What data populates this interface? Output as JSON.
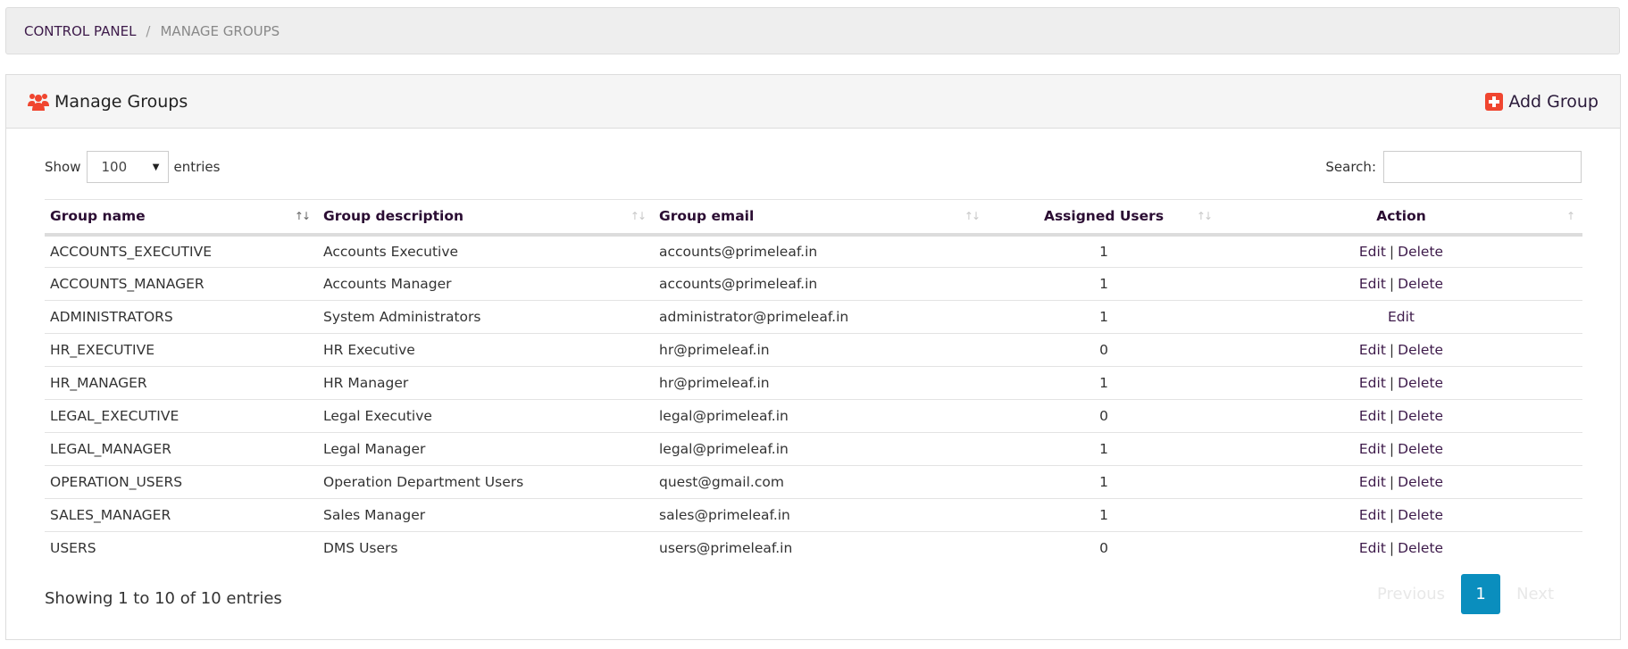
{
  "breadcrumb": {
    "items": [
      "CONTROL PANEL",
      "MANAGE GROUPS"
    ],
    "separator": "/"
  },
  "panel": {
    "title": "Manage Groups",
    "title_icon": "users-icon",
    "add_button": "Add Group",
    "add_icon": "plus-square-icon",
    "accent_color": "#f0452f"
  },
  "controls": {
    "show_label": "Show",
    "page_length": "100",
    "entries_label": "entries",
    "search_label": "Search:",
    "search_value": ""
  },
  "table": {
    "columns": [
      "Group name",
      "Group description",
      "Group email",
      "Assigned Users",
      "Action"
    ],
    "rows": [
      {
        "name": "ACCOUNTS_EXECUTIVE",
        "description": "Accounts Executive",
        "email": "accounts@primeleaf.in",
        "users": "1",
        "edit": "Edit",
        "delete": "Delete"
      },
      {
        "name": "ACCOUNTS_MANAGER",
        "description": "Accounts Manager",
        "email": "accounts@primeleaf.in",
        "users": "1",
        "edit": "Edit",
        "delete": "Delete"
      },
      {
        "name": "ADMINISTRATORS",
        "description": "System Administrators",
        "email": "administrator@primeleaf.in",
        "users": "1",
        "edit": "Edit",
        "delete": null
      },
      {
        "name": "HR_EXECUTIVE",
        "description": "HR Executive",
        "email": "hr@primeleaf.in",
        "users": "0",
        "edit": "Edit",
        "delete": "Delete"
      },
      {
        "name": "HR_MANAGER",
        "description": "HR Manager",
        "email": "hr@primeleaf.in",
        "users": "1",
        "edit": "Edit",
        "delete": "Delete"
      },
      {
        "name": "LEGAL_EXECUTIVE",
        "description": "Legal Executive",
        "email": "legal@primeleaf.in",
        "users": "0",
        "edit": "Edit",
        "delete": "Delete"
      },
      {
        "name": "LEGAL_MANAGER",
        "description": "Legal Manager",
        "email": "legal@primeleaf.in",
        "users": "1",
        "edit": "Edit",
        "delete": "Delete"
      },
      {
        "name": "OPERATION_USERS",
        "description": "Operation Department Users",
        "email": "quest@gmail.com",
        "users": "1",
        "edit": "Edit",
        "delete": "Delete"
      },
      {
        "name": "SALES_MANAGER",
        "description": "Sales Manager",
        "email": "sales@primeleaf.in",
        "users": "1",
        "edit": "Edit",
        "delete": "Delete"
      },
      {
        "name": "USERS",
        "description": "DMS Users",
        "email": "users@primeleaf.in",
        "users": "0",
        "edit": "Edit",
        "delete": "Delete"
      }
    ]
  },
  "footer": {
    "info": "Showing 1 to 10 of 10 entries",
    "previous": "Previous",
    "current_page": "1",
    "next": "Next",
    "page_color": "#0a8ebe"
  }
}
